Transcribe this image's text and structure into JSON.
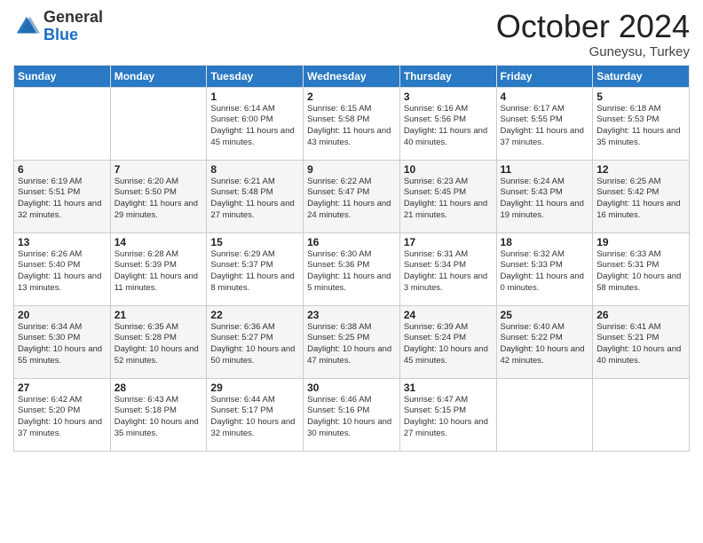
{
  "logo": {
    "general": "General",
    "blue": "Blue"
  },
  "header": {
    "month": "October 2024",
    "location": "Guneysu, Turkey"
  },
  "weekdays": [
    "Sunday",
    "Monday",
    "Tuesday",
    "Wednesday",
    "Thursday",
    "Friday",
    "Saturday"
  ],
  "weeks": [
    [
      {
        "day": "",
        "sunrise": "",
        "sunset": "",
        "daylight": ""
      },
      {
        "day": "",
        "sunrise": "",
        "sunset": "",
        "daylight": ""
      },
      {
        "day": "1",
        "sunrise": "Sunrise: 6:14 AM",
        "sunset": "Sunset: 6:00 PM",
        "daylight": "Daylight: 11 hours and 45 minutes."
      },
      {
        "day": "2",
        "sunrise": "Sunrise: 6:15 AM",
        "sunset": "Sunset: 5:58 PM",
        "daylight": "Daylight: 11 hours and 43 minutes."
      },
      {
        "day": "3",
        "sunrise": "Sunrise: 6:16 AM",
        "sunset": "Sunset: 5:56 PM",
        "daylight": "Daylight: 11 hours and 40 minutes."
      },
      {
        "day": "4",
        "sunrise": "Sunrise: 6:17 AM",
        "sunset": "Sunset: 5:55 PM",
        "daylight": "Daylight: 11 hours and 37 minutes."
      },
      {
        "day": "5",
        "sunrise": "Sunrise: 6:18 AM",
        "sunset": "Sunset: 5:53 PM",
        "daylight": "Daylight: 11 hours and 35 minutes."
      }
    ],
    [
      {
        "day": "6",
        "sunrise": "Sunrise: 6:19 AM",
        "sunset": "Sunset: 5:51 PM",
        "daylight": "Daylight: 11 hours and 32 minutes."
      },
      {
        "day": "7",
        "sunrise": "Sunrise: 6:20 AM",
        "sunset": "Sunset: 5:50 PM",
        "daylight": "Daylight: 11 hours and 29 minutes."
      },
      {
        "day": "8",
        "sunrise": "Sunrise: 6:21 AM",
        "sunset": "Sunset: 5:48 PM",
        "daylight": "Daylight: 11 hours and 27 minutes."
      },
      {
        "day": "9",
        "sunrise": "Sunrise: 6:22 AM",
        "sunset": "Sunset: 5:47 PM",
        "daylight": "Daylight: 11 hours and 24 minutes."
      },
      {
        "day": "10",
        "sunrise": "Sunrise: 6:23 AM",
        "sunset": "Sunset: 5:45 PM",
        "daylight": "Daylight: 11 hours and 21 minutes."
      },
      {
        "day": "11",
        "sunrise": "Sunrise: 6:24 AM",
        "sunset": "Sunset: 5:43 PM",
        "daylight": "Daylight: 11 hours and 19 minutes."
      },
      {
        "day": "12",
        "sunrise": "Sunrise: 6:25 AM",
        "sunset": "Sunset: 5:42 PM",
        "daylight": "Daylight: 11 hours and 16 minutes."
      }
    ],
    [
      {
        "day": "13",
        "sunrise": "Sunrise: 6:26 AM",
        "sunset": "Sunset: 5:40 PM",
        "daylight": "Daylight: 11 hours and 13 minutes."
      },
      {
        "day": "14",
        "sunrise": "Sunrise: 6:28 AM",
        "sunset": "Sunset: 5:39 PM",
        "daylight": "Daylight: 11 hours and 11 minutes."
      },
      {
        "day": "15",
        "sunrise": "Sunrise: 6:29 AM",
        "sunset": "Sunset: 5:37 PM",
        "daylight": "Daylight: 11 hours and 8 minutes."
      },
      {
        "day": "16",
        "sunrise": "Sunrise: 6:30 AM",
        "sunset": "Sunset: 5:36 PM",
        "daylight": "Daylight: 11 hours and 5 minutes."
      },
      {
        "day": "17",
        "sunrise": "Sunrise: 6:31 AM",
        "sunset": "Sunset: 5:34 PM",
        "daylight": "Daylight: 11 hours and 3 minutes."
      },
      {
        "day": "18",
        "sunrise": "Sunrise: 6:32 AM",
        "sunset": "Sunset: 5:33 PM",
        "daylight": "Daylight: 11 hours and 0 minutes."
      },
      {
        "day": "19",
        "sunrise": "Sunrise: 6:33 AM",
        "sunset": "Sunset: 5:31 PM",
        "daylight": "Daylight: 10 hours and 58 minutes."
      }
    ],
    [
      {
        "day": "20",
        "sunrise": "Sunrise: 6:34 AM",
        "sunset": "Sunset: 5:30 PM",
        "daylight": "Daylight: 10 hours and 55 minutes."
      },
      {
        "day": "21",
        "sunrise": "Sunrise: 6:35 AM",
        "sunset": "Sunset: 5:28 PM",
        "daylight": "Daylight: 10 hours and 52 minutes."
      },
      {
        "day": "22",
        "sunrise": "Sunrise: 6:36 AM",
        "sunset": "Sunset: 5:27 PM",
        "daylight": "Daylight: 10 hours and 50 minutes."
      },
      {
        "day": "23",
        "sunrise": "Sunrise: 6:38 AM",
        "sunset": "Sunset: 5:25 PM",
        "daylight": "Daylight: 10 hours and 47 minutes."
      },
      {
        "day": "24",
        "sunrise": "Sunrise: 6:39 AM",
        "sunset": "Sunset: 5:24 PM",
        "daylight": "Daylight: 10 hours and 45 minutes."
      },
      {
        "day": "25",
        "sunrise": "Sunrise: 6:40 AM",
        "sunset": "Sunset: 5:22 PM",
        "daylight": "Daylight: 10 hours and 42 minutes."
      },
      {
        "day": "26",
        "sunrise": "Sunrise: 6:41 AM",
        "sunset": "Sunset: 5:21 PM",
        "daylight": "Daylight: 10 hours and 40 minutes."
      }
    ],
    [
      {
        "day": "27",
        "sunrise": "Sunrise: 6:42 AM",
        "sunset": "Sunset: 5:20 PM",
        "daylight": "Daylight: 10 hours and 37 minutes."
      },
      {
        "day": "28",
        "sunrise": "Sunrise: 6:43 AM",
        "sunset": "Sunset: 5:18 PM",
        "daylight": "Daylight: 10 hours and 35 minutes."
      },
      {
        "day": "29",
        "sunrise": "Sunrise: 6:44 AM",
        "sunset": "Sunset: 5:17 PM",
        "daylight": "Daylight: 10 hours and 32 minutes."
      },
      {
        "day": "30",
        "sunrise": "Sunrise: 6:46 AM",
        "sunset": "Sunset: 5:16 PM",
        "daylight": "Daylight: 10 hours and 30 minutes."
      },
      {
        "day": "31",
        "sunrise": "Sunrise: 6:47 AM",
        "sunset": "Sunset: 5:15 PM",
        "daylight": "Daylight: 10 hours and 27 minutes."
      },
      {
        "day": "",
        "sunrise": "",
        "sunset": "",
        "daylight": ""
      },
      {
        "day": "",
        "sunrise": "",
        "sunset": "",
        "daylight": ""
      }
    ]
  ]
}
